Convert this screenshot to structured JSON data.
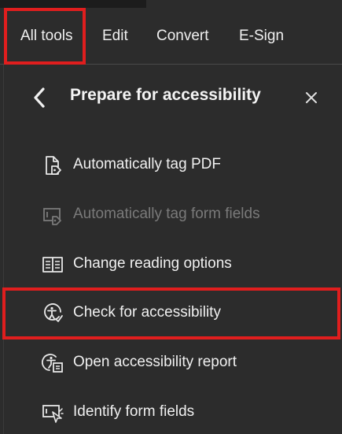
{
  "tabs": {
    "all_tools": "All tools",
    "edit": "Edit",
    "convert": "Convert",
    "esign": "E-Sign"
  },
  "panel": {
    "title": "Prepare for accessibility",
    "back_icon": "chevron-left-icon",
    "close_icon": "close-icon"
  },
  "tools": [
    {
      "label": "Automatically tag PDF",
      "icon": "auto-tag-pdf-icon",
      "enabled": true
    },
    {
      "label": "Automatically tag form fields",
      "icon": "auto-tag-form-fields-icon",
      "enabled": false
    },
    {
      "label": "Change reading options",
      "icon": "reading-options-icon",
      "enabled": true
    },
    {
      "label": "Check for accessibility",
      "icon": "accessibility-check-icon",
      "enabled": true
    },
    {
      "label": "Open accessibility report",
      "icon": "accessibility-report-icon",
      "enabled": true
    },
    {
      "label": "Identify form fields",
      "icon": "identify-form-fields-icon",
      "enabled": true
    }
  ],
  "colors": {
    "background": "#2c2c2c",
    "text": "#f0f0f0",
    "disabled_text": "#7a7a7a",
    "highlight": "#e01e1e"
  }
}
